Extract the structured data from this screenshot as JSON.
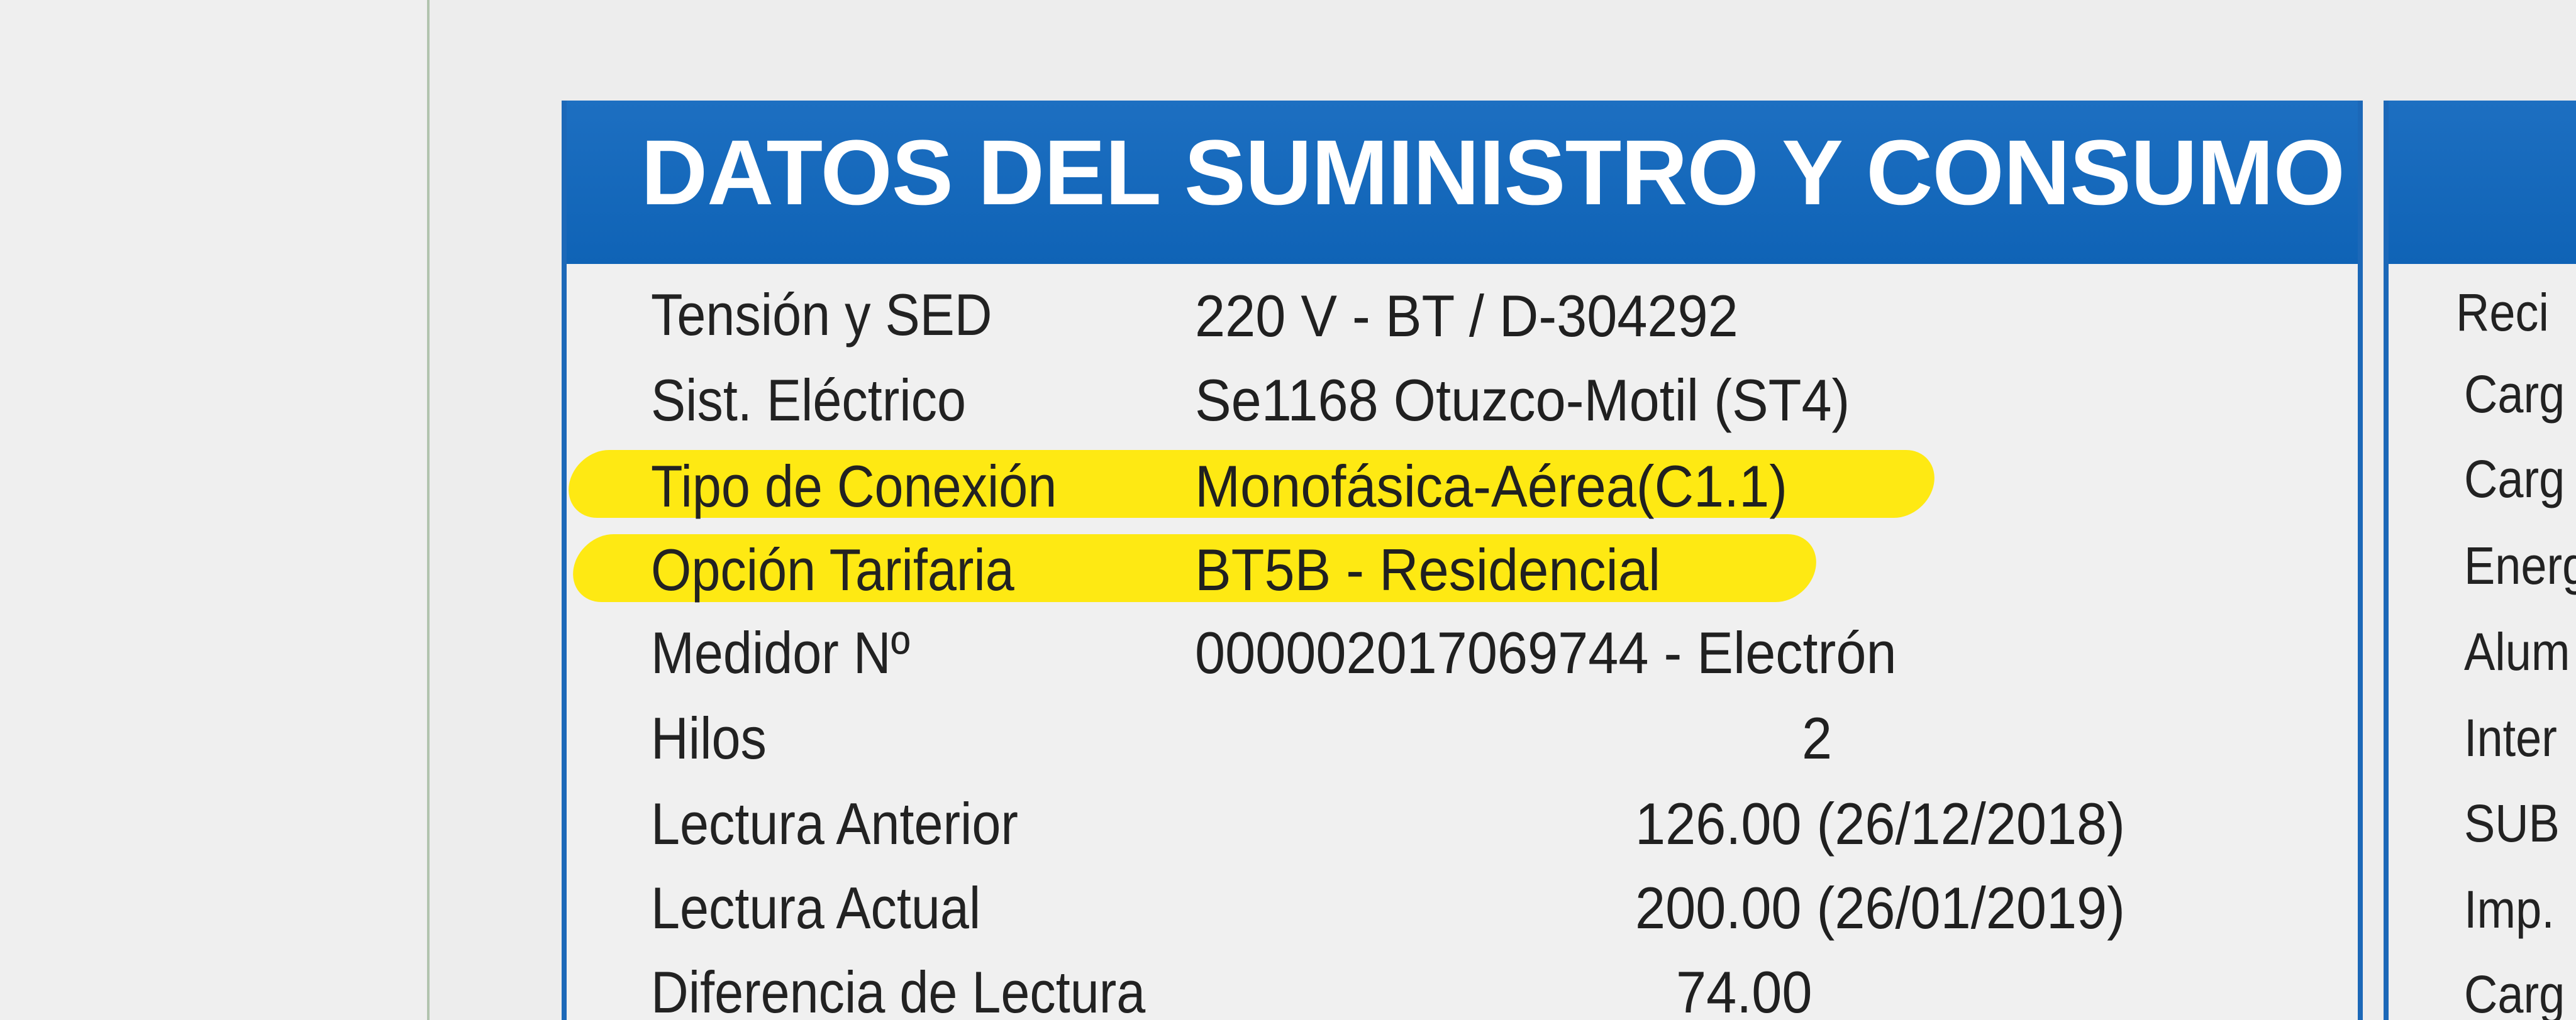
{
  "document": {
    "section_title": "DATOS DEL SUMINISTRO Y CONSUMO",
    "rows": [
      {
        "label": "Tensión  y SED",
        "value": "220 V - BT / D-304292"
      },
      {
        "label": "Sist. Eléctrico",
        "value": "Se1168 Otuzco-Motil (ST4)"
      },
      {
        "label": "Tipo de Conexión",
        "value": "Monofásica-Aérea(C1.1)"
      },
      {
        "label": "Opción Tarifaria",
        "value": "BT5B   -   Residencial"
      },
      {
        "label": "Medidor Nº",
        "value": "000002017069744 - Electrón"
      },
      {
        "label": "Hilos",
        "value": "2"
      },
      {
        "label": "Lectura Anterior",
        "value": "126.00 (26/12/2018)"
      },
      {
        "label": "Lectura Actual",
        "value": "200.00 (26/01/2019)"
      },
      {
        "label": "Diferencia de Lectura",
        "value": "74.00"
      }
    ],
    "right_panel_labels": [
      "Reci",
      "Carg",
      "Carg",
      "Energ",
      "Alum",
      "Inter",
      "SUB",
      "Imp.",
      "Carg"
    ]
  },
  "colors": {
    "header_blue": "#1565c0",
    "highlight_yellow": "#ffe800",
    "background": "#eeeeee"
  }
}
